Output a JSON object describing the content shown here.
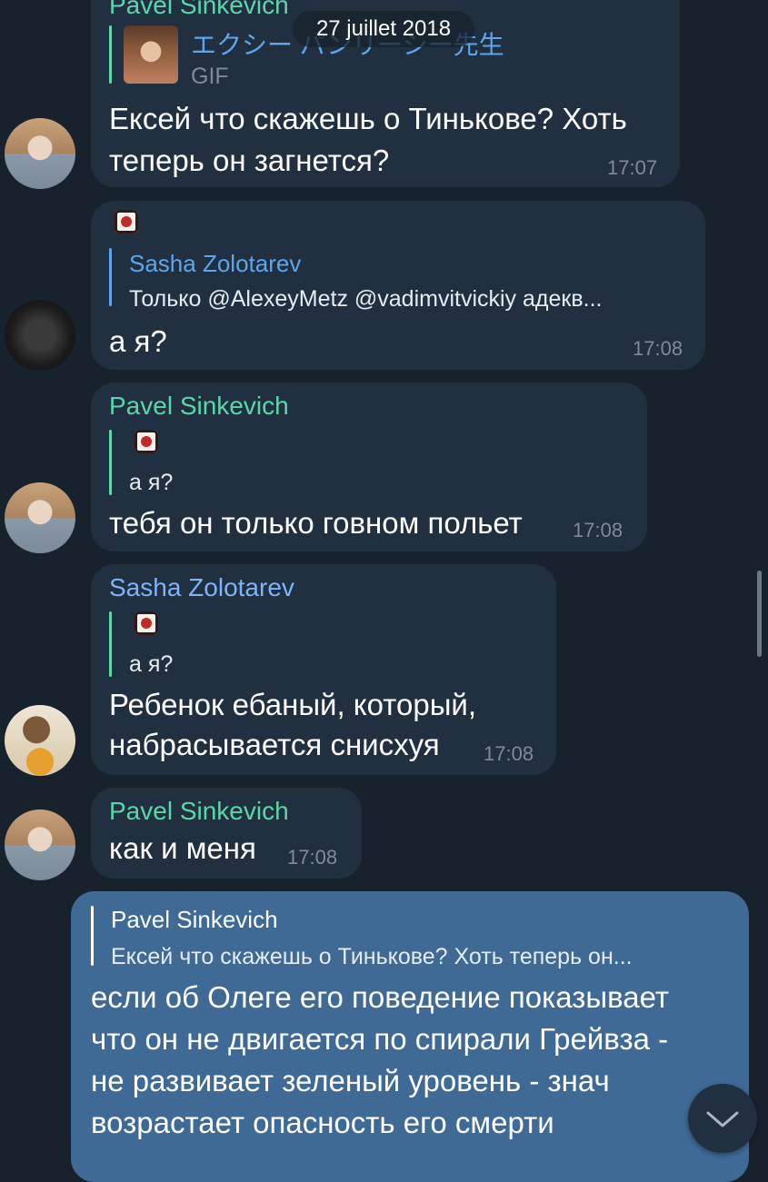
{
  "date_label": "27 juillet 2018",
  "messages": [
    {
      "sender": "Pavel Sinkevich",
      "reply": {
        "name": "エクシー パンリーシー先生",
        "text": "GIF"
      },
      "lines": [
        "Ексей что скажешь о Тинькове? Хоть",
        "теперь он загнется?"
      ],
      "time": "17:07"
    },
    {
      "sender": "",
      "reply": {
        "name": "Sasha Zolotarev",
        "text": "Только @AlexeyMetz @vadimvitvickiy адекв..."
      },
      "lines": [
        "а я?"
      ],
      "time": "17:08"
    },
    {
      "sender": "Pavel Sinkevich",
      "reply": {
        "name": "",
        "text": "а я?"
      },
      "lines": [
        "тебя он только говном польет"
      ],
      "time": "17:08"
    },
    {
      "sender": "Sasha Zolotarev",
      "reply": {
        "name": "",
        "text": "а я?"
      },
      "lines": [
        "Ребенок ебаный, который,",
        "набрасывается снисхуя"
      ],
      "time": "17:08"
    },
    {
      "sender": "Pavel Sinkevich",
      "lines": [
        "как и меня"
      ],
      "time": "17:08"
    },
    {
      "reply": {
        "name": "Pavel Sinkevich",
        "text": "Ексей что скажешь о Тинькове? Хоть теперь он..."
      },
      "lines": [
        "если об Олеге его поведение показывает",
        "что он не двигается по спирали Грейвза -",
        "не развивает зеленый уровень - знач",
        "возрастает опасность его смерти"
      ]
    }
  ],
  "colors": {
    "background": "#18222d",
    "incoming_bubble": "#213041",
    "outgoing_bubble": "#3e6a95",
    "green_name": "#5cd6a9",
    "blue_name": "#7fb3f5",
    "time": "#7d8b99"
  }
}
